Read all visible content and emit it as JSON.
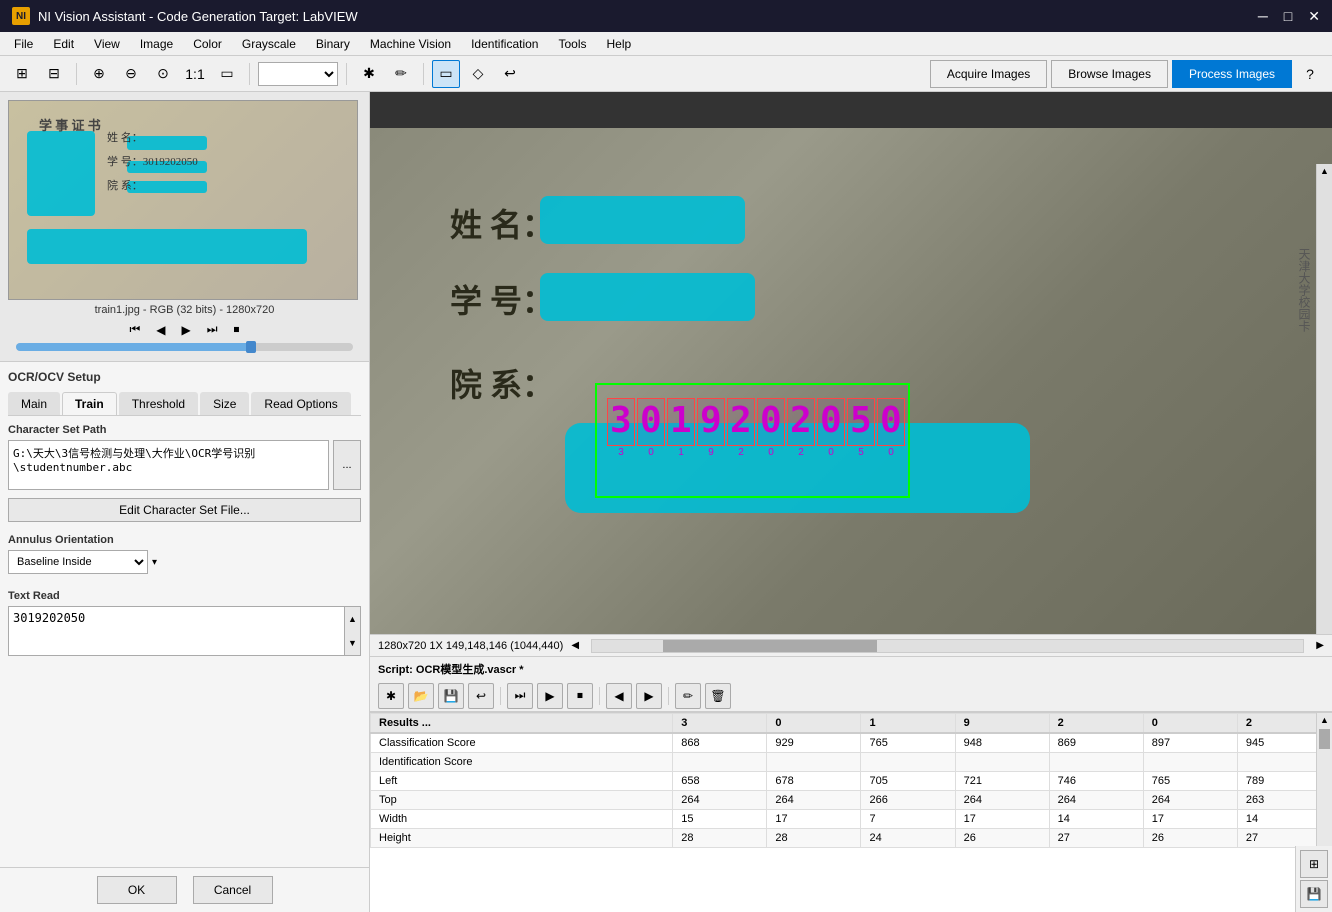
{
  "window": {
    "title": "NI Vision Assistant - Code Generation Target: LabVIEW",
    "icon_label": "NI"
  },
  "win_controls": {
    "minimize": "─",
    "maximize": "□",
    "close": "✕"
  },
  "menu": {
    "items": [
      "File",
      "Edit",
      "View",
      "Image",
      "Color",
      "Grayscale",
      "Binary",
      "Machine Vision",
      "Identification",
      "Tools",
      "Help"
    ]
  },
  "toolbar": {
    "dropdown_value": ""
  },
  "process_bar": {
    "acquire": "Acquire Images",
    "browse": "Browse Images",
    "process": "Process Images"
  },
  "left_panel": {
    "thumb_label": "train1.jpg - RGB (32 bits) - 1280x720",
    "ocr_title": "OCR/OCV Setup",
    "tabs": [
      "Main",
      "Train",
      "Threshold",
      "Size",
      "Read Options"
    ],
    "active_tab": "Train",
    "char_set": {
      "label": "Character Set Path",
      "path": "G:\\天大\\3信号检测与处理\\大作业\\OCR学号识别\\studentnumber.abc",
      "browse_label": "...",
      "edit_btn": "Edit Character Set File..."
    },
    "annulus": {
      "label": "Annulus Orientation",
      "options": [
        "Baseline Inside"
      ],
      "selected": "Baseline Inside"
    },
    "text_read": {
      "label": "Text Read",
      "value": "3019202050"
    },
    "ok_btn": "OK",
    "cancel_btn": "Cancel"
  },
  "image_view": {
    "status_text": "1280x720  1X  149,148,146    (1044,440)",
    "scroll_left": "◀",
    "scroll_right": "▶"
  },
  "script_bar": {
    "label": "Script: OCR模型生成.vascr *"
  },
  "script_toolbar": {
    "btns": [
      "✱",
      "📁",
      "💾",
      "↩",
      "⏭",
      "▶",
      "⏹",
      "◀",
      "▶",
      "✏",
      "🗑"
    ]
  },
  "results_table": {
    "columns": [
      "Results ...",
      "3",
      "0",
      "1",
      "9",
      "2",
      "0",
      "2"
    ],
    "rows": [
      {
        "label": "Classification Score",
        "vals": [
          "868",
          "929",
          "765",
          "948",
          "869",
          "897",
          "945"
        ]
      },
      {
        "label": "Identification Score",
        "vals": [
          "",
          "",
          "",
          "",
          "",
          "",
          ""
        ]
      },
      {
        "label": "Left",
        "vals": [
          "658",
          "678",
          "705",
          "721",
          "746",
          "765",
          "789"
        ]
      },
      {
        "label": "Top",
        "vals": [
          "264",
          "264",
          "266",
          "264",
          "264",
          "264",
          "263"
        ]
      },
      {
        "label": "Width",
        "vals": [
          "15",
          "17",
          "7",
          "17",
          "14",
          "17",
          "14"
        ]
      },
      {
        "label": "Height",
        "vals": [
          "28",
          "28",
          "24",
          "26",
          "27",
          "26",
          "27"
        ]
      }
    ]
  },
  "ocr_digits": {
    "chars": [
      "3",
      "0",
      "1",
      "9",
      "2",
      "0",
      "2",
      "0",
      "5",
      "0"
    ],
    "labels": [
      "3",
      "0",
      "1",
      "9",
      "2",
      "0",
      "2",
      "0",
      "5",
      "0"
    ]
  },
  "icons": {
    "help": "?",
    "zoom_in": "🔍",
    "zoom_out": "🔍",
    "fit": "⊞",
    "diamond": "◇",
    "undo": "↩",
    "select_rect": "▭",
    "snap": "⊕",
    "save_script": "💾",
    "load_img": "📂",
    "chevron_down": "▾"
  }
}
